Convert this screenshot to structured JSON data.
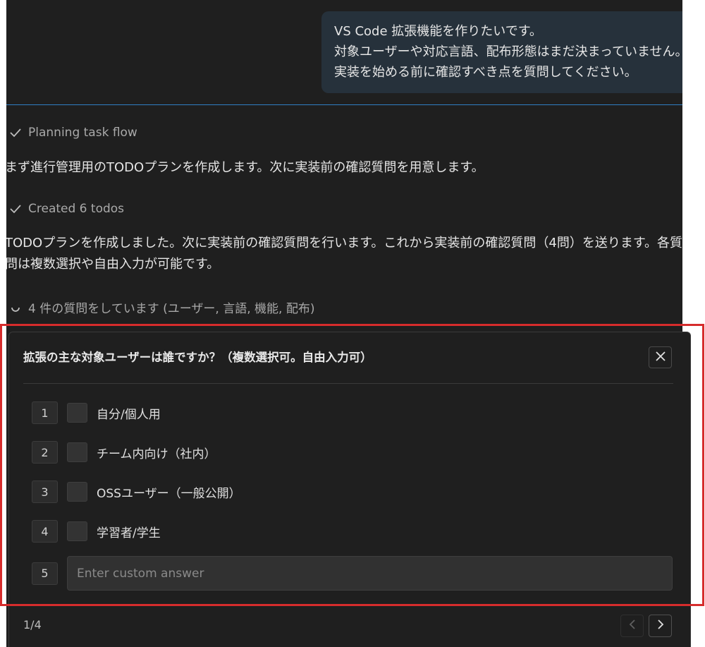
{
  "user_message": {
    "lines": [
      "VS Code 拡張機能を作りたいです。",
      "対象ユーザーや対応言語、配布形態はまだ決まっていません。",
      "実装を始める前に確認すべき点を質問してください。"
    ]
  },
  "steps": [
    {
      "icon": "check-icon",
      "label": "Planning task flow"
    },
    {
      "icon": "check-icon",
      "label": "Created 6 todos"
    },
    {
      "icon": "spinner-icon",
      "label": "4 件の質問をしています (ユーザー, 言語, 機能, 配布)"
    }
  ],
  "messages": [
    {
      "lines": [
        "まず進行管理用のTODOプランを作成します。次に実装前の確認質問を用意します。"
      ]
    },
    {
      "lines": [
        "TODOプランを作成しました。次に実装前の確認質問を行います。これから実装前の確認質問（4問）を送ります。各質",
        "問は複数選択や自由入力が可能です。"
      ]
    }
  ],
  "question": {
    "title": "拡張の主な対象ユーザーは誰ですか？（複数選択可。自由入力可）",
    "options": [
      {
        "number": "1",
        "label": "自分/個人用",
        "checked": false
      },
      {
        "number": "2",
        "label": "チーム内向け（社内）",
        "checked": false
      },
      {
        "number": "3",
        "label": "OSSユーザー（一般公開）",
        "checked": false
      },
      {
        "number": "4",
        "label": "学習者/学生",
        "checked": false
      }
    ],
    "custom": {
      "number": "5",
      "placeholder": "Enter custom answer",
      "value": ""
    },
    "pager": "1/4"
  },
  "colors": {
    "panel_bg": "#1f1f1f",
    "bubble_bg": "#26313b",
    "accent_blue": "#2f7ec4",
    "highlight_red": "#d62c2c"
  }
}
